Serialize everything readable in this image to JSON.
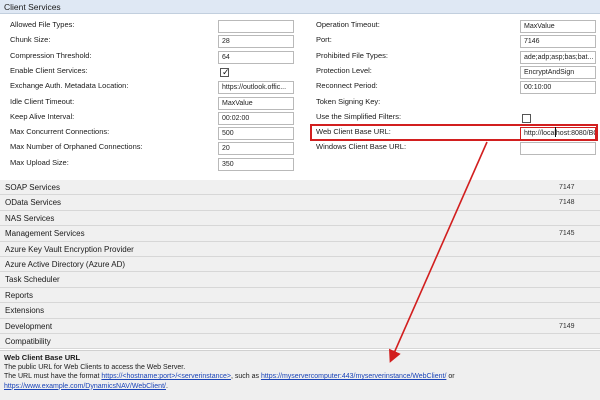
{
  "section_title": "Client Services",
  "left_fields": [
    {
      "label": "Allowed File Types:",
      "value": "",
      "type": "text"
    },
    {
      "label": "Chunk Size:",
      "value": "28",
      "type": "text"
    },
    {
      "label": "Compression Threshold:",
      "value": "64",
      "type": "text"
    },
    {
      "label": "Enable Client Services:",
      "value": "",
      "type": "checkbox",
      "checked": true
    },
    {
      "label": "Exchange Auth. Metadata Location:",
      "value": "https://outlook.offic...",
      "type": "text"
    },
    {
      "label": "Idle Client Timeout:",
      "value": "MaxValue",
      "type": "text"
    },
    {
      "label": "Keep Alive Interval:",
      "value": "00:02:00",
      "type": "text"
    },
    {
      "label": "Max Concurrent Connections:",
      "value": "500",
      "type": "text"
    },
    {
      "label": "Max Number of Orphaned Connections:",
      "value": "20",
      "type": "text"
    },
    {
      "label": "Max Upload Size:",
      "value": "350",
      "type": "text"
    }
  ],
  "right_fields": [
    {
      "label": "Operation Timeout:",
      "value": "MaxValue",
      "type": "text"
    },
    {
      "label": "Port:",
      "value": "7146",
      "type": "text"
    },
    {
      "label": "Prohibited File Types:",
      "value": "ade;adp;asp;bas;bat...",
      "type": "text"
    },
    {
      "label": "Protection Level:",
      "value": "EncryptAndSign",
      "type": "select"
    },
    {
      "label": "Reconnect Period:",
      "value": "00:10:00",
      "type": "text"
    },
    {
      "label": "Token Signing Key:",
      "value": "",
      "type": "none"
    },
    {
      "label": "Use the Simplified Filters:",
      "value": "",
      "type": "checkbox",
      "checked": false
    },
    {
      "label": "Web Client Base URL:",
      "value": "http://localhost:8080/BC",
      "type": "text"
    },
    {
      "label": "Windows Client Base URL:",
      "value": "",
      "type": "text"
    }
  ],
  "categories": [
    {
      "label": "SOAP Services",
      "value": "7147"
    },
    {
      "label": "OData Services",
      "value": "7148"
    },
    {
      "label": "NAS Services",
      "value": ""
    },
    {
      "label": "Management Services",
      "value": "7145"
    },
    {
      "label": "Azure Key Vault Encryption Provider",
      "value": ""
    },
    {
      "label": "Azure Active Directory (Azure AD)",
      "value": ""
    },
    {
      "label": "Task Scheduler",
      "value": ""
    },
    {
      "label": "Reports",
      "value": ""
    },
    {
      "label": "Extensions",
      "value": ""
    },
    {
      "label": "Development",
      "value": "7149"
    },
    {
      "label": "Compatibility",
      "value": ""
    }
  ],
  "description": {
    "title": "Web Client Base URL",
    "line1": "The public URL for Web Clients to access the Web Server.",
    "line2_prefix": "The URL must have the format ",
    "link1": "https://<hostname:port>/<serverinstance>",
    "line2_mid": ", such as ",
    "link2": "https://myservercomputer:443/myserverinstance/WebClient/",
    "line2_suffix": " or",
    "link3": "https://www.example.com/DynamicsNAV/WebClient/",
    "line3_suffix": "."
  },
  "colors": {
    "highlight": "#d21f1f",
    "section_header_bg": "#dfe8f4",
    "link": "#1a44b8"
  }
}
